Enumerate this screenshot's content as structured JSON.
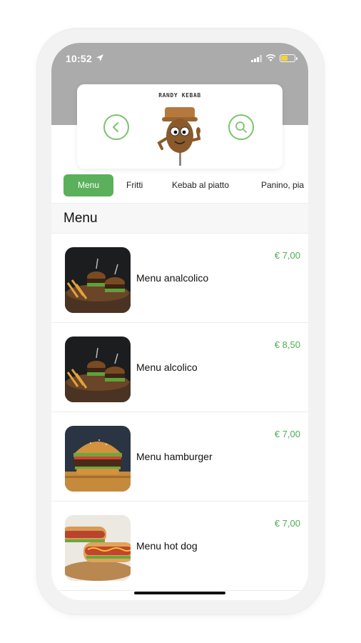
{
  "status_bar": {
    "time": "10:52"
  },
  "header": {
    "brand": "RANDY KEBAB",
    "accent_color": "#7ac46b"
  },
  "tabs": [
    {
      "label": "Menu",
      "active": true
    },
    {
      "label": "Fritti",
      "active": false
    },
    {
      "label": "Kebab al piatto",
      "active": false
    },
    {
      "label": "Panino, pia",
      "active": false
    }
  ],
  "section": {
    "title": "Menu"
  },
  "items": [
    {
      "name": "Menu analcolico",
      "price": "€ 7,00",
      "image": "kebab-platter-dark"
    },
    {
      "name": "Menu alcolico",
      "price": "€ 8,50",
      "image": "kebab-platter-dark"
    },
    {
      "name": "Menu hamburger",
      "price": "€ 7,00",
      "image": "hamburger"
    },
    {
      "name": "Menu hot dog",
      "price": "€ 7,00",
      "image": "hot-dog"
    }
  ],
  "colors": {
    "tab_active": "#5bb05c",
    "price": "#4caf50",
    "header_bg": "#ababab"
  }
}
